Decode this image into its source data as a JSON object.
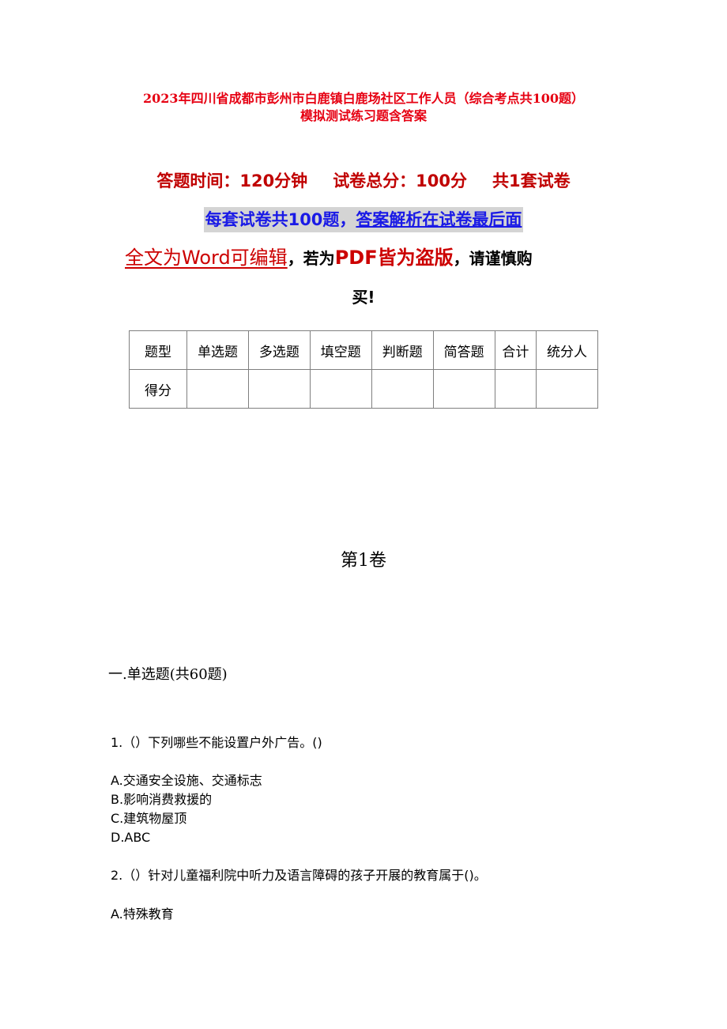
{
  "document": {
    "title_line1": "2023年四川省成都市彭州市白鹿镇白鹿场社区工作人员（综合考点共100题）",
    "title_line2": "模拟测试练习题含答案",
    "meta": {
      "time": "答题时间：120分钟",
      "total_score": "试卷总分：100分",
      "sets": "共1套试卷"
    },
    "banner": {
      "part1": "每套试卷共100题，",
      "part2": "答案解析在试卷最后面"
    },
    "notice": {
      "part1": "全文为Word可编辑",
      "sep1": "，若为",
      "part2": "PDF皆为盗版",
      "part3": "，请谨慎购",
      "line2": "买!"
    },
    "score_table": {
      "header": [
        "题型",
        "单选题",
        "多选题",
        "填空题",
        "判断题",
        "简答题",
        "合计",
        "统分人"
      ],
      "row": [
        "得分",
        "",
        "",
        "",
        "",
        "",
        "",
        ""
      ]
    },
    "volume_title": "第1卷",
    "section_title": "一.单选题(共60题)",
    "questions": [
      {
        "stem": "1.（）下列哪些不能设置户外广告。()",
        "options": [
          "A.交通安全设施、交通标志",
          "B.影响消费救援的",
          "C.建筑物屋顶",
          "D.ABC"
        ]
      },
      {
        "stem": "2.（）针对儿童福利院中听力及语言障碍的孩子开展的教育属于()。",
        "options": [
          "A.特殊教育"
        ]
      }
    ]
  }
}
